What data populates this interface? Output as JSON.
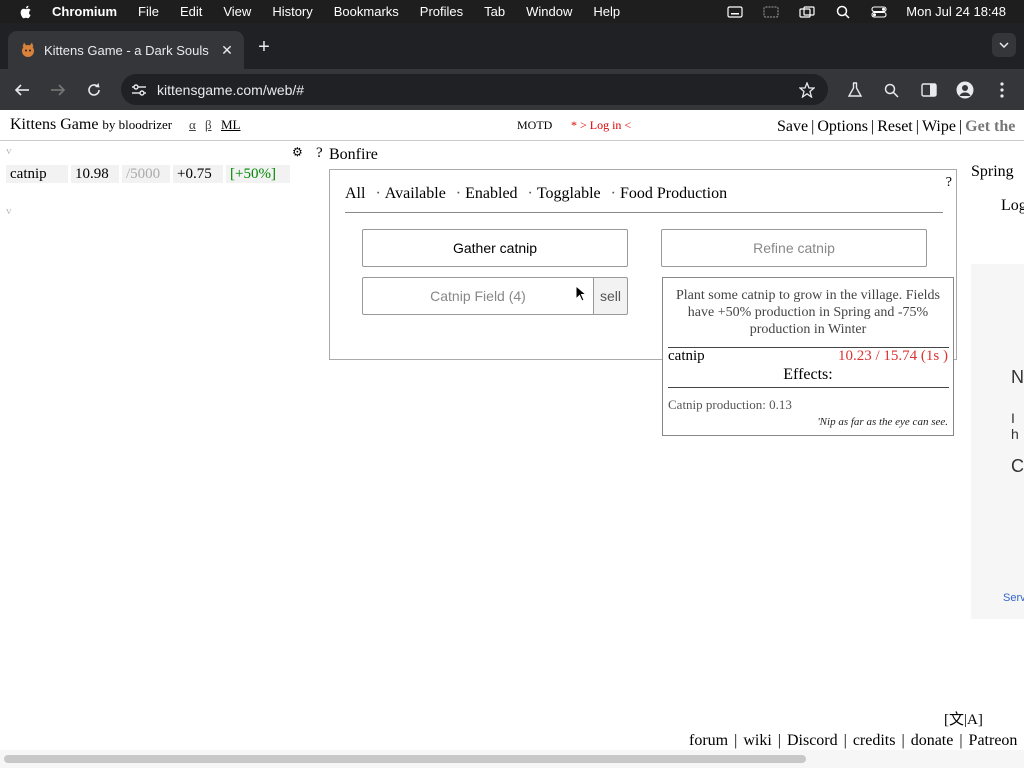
{
  "macos": {
    "menus": [
      "Chromium",
      "File",
      "Edit",
      "View",
      "History",
      "Bookmarks",
      "Profiles",
      "Tab",
      "Window",
      "Help"
    ],
    "clock": "Mon Jul 24  18:48"
  },
  "browser": {
    "tab_title": "Kittens Game - a Dark Souls",
    "url": "kittensgame.com/web/#"
  },
  "header": {
    "title": "Kittens Game",
    "by": "by bloodrizer",
    "alpha": "α",
    "beta": "β",
    "ml": "ML",
    "motd": "MOTD",
    "login": "* > Log in <",
    "links": [
      "Save",
      "Options",
      "Reset",
      "Wipe"
    ],
    "get_the": "Get the"
  },
  "resources": {
    "toggle_top": "v",
    "toggle_bottom": "v",
    "gear": "⚙",
    "rows": [
      {
        "name": "catnip",
        "amount": "10.98",
        "max": "/5000",
        "rate": "+0.75",
        "bonus": "[+50%]"
      }
    ]
  },
  "bonfire": {
    "help": "?",
    "label": "Bonfire",
    "panel_help": "?",
    "filters": [
      "All",
      "Available",
      "Enabled",
      "Togglable",
      "Food Production"
    ],
    "gather": "Gather catnip",
    "refine": "Refine catnip",
    "field": "Catnip Field (4)",
    "sell": "sell"
  },
  "tooltip": {
    "description": "Plant some catnip to grow in the village. Fields have +50% production in Spring and -75% production in Winter",
    "resource": "catnip",
    "cost": "10.23 / 15.74 (1s )",
    "effects_title": "Effects:",
    "production": "Catnip production: 0.13",
    "flavor": "'Nip as far as the eye can see."
  },
  "right": {
    "season": "Spring",
    "log": "Log",
    "partial_n": "N",
    "partial_i": "I h",
    "partial_c": "C",
    "partial_serv": "Serv"
  },
  "footer": {
    "lang": "[文|A]",
    "links": [
      "forum",
      "wiki",
      "Discord",
      "credits",
      "donate",
      "Patreon"
    ]
  }
}
